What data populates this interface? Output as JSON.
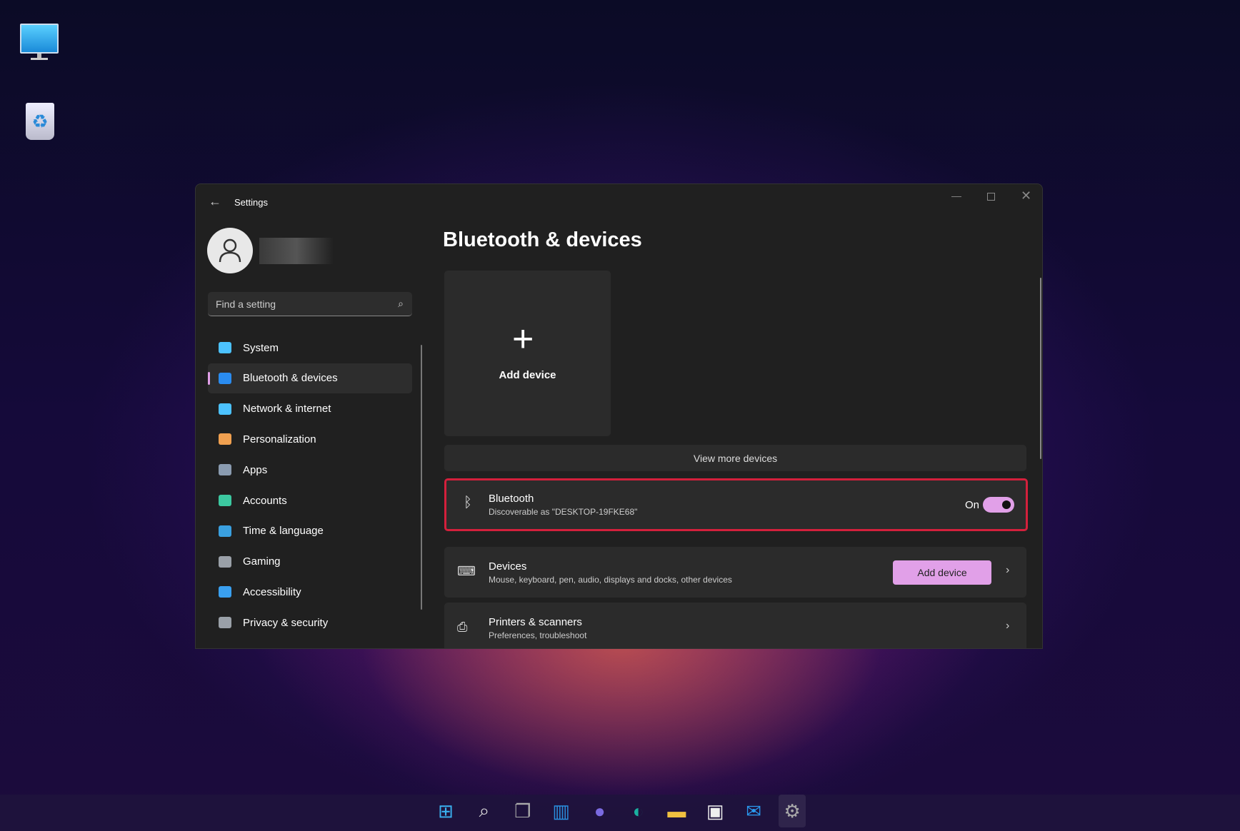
{
  "window": {
    "title": "Settings",
    "page_title": "Bluetooth & devices"
  },
  "search": {
    "placeholder": "Find a setting"
  },
  "nav": [
    {
      "label": "System",
      "color": "#4cc2ff"
    },
    {
      "label": "Bluetooth & devices",
      "color": "#2a8cf0",
      "selected": true
    },
    {
      "label": "Network & internet",
      "color": "#4cc2ff"
    },
    {
      "label": "Personalization",
      "color": "#f0a050"
    },
    {
      "label": "Apps",
      "color": "#8a9bb0"
    },
    {
      "label": "Accounts",
      "color": "#3cc8a0"
    },
    {
      "label": "Time & language",
      "color": "#3aa0e0"
    },
    {
      "label": "Gaming",
      "color": "#9aa0a8"
    },
    {
      "label": "Accessibility",
      "color": "#3aa0f0"
    },
    {
      "label": "Privacy & security",
      "color": "#9aa0a8"
    }
  ],
  "tile": {
    "label": "Add device"
  },
  "view_more": "View more devices",
  "bluetooth": {
    "title": "Bluetooth",
    "subtitle": "Discoverable as \"DESKTOP-19FKE68\"",
    "state": "On",
    "on": true
  },
  "devices": {
    "title": "Devices",
    "subtitle": "Mouse, keyboard, pen, audio, displays and docks, other devices",
    "button": "Add device"
  },
  "printers": {
    "title": "Printers & scanners",
    "subtitle": "Preferences, troubleshoot"
  },
  "colors": {
    "accent": "#e1a0e8",
    "highlight": "#d4203c"
  }
}
